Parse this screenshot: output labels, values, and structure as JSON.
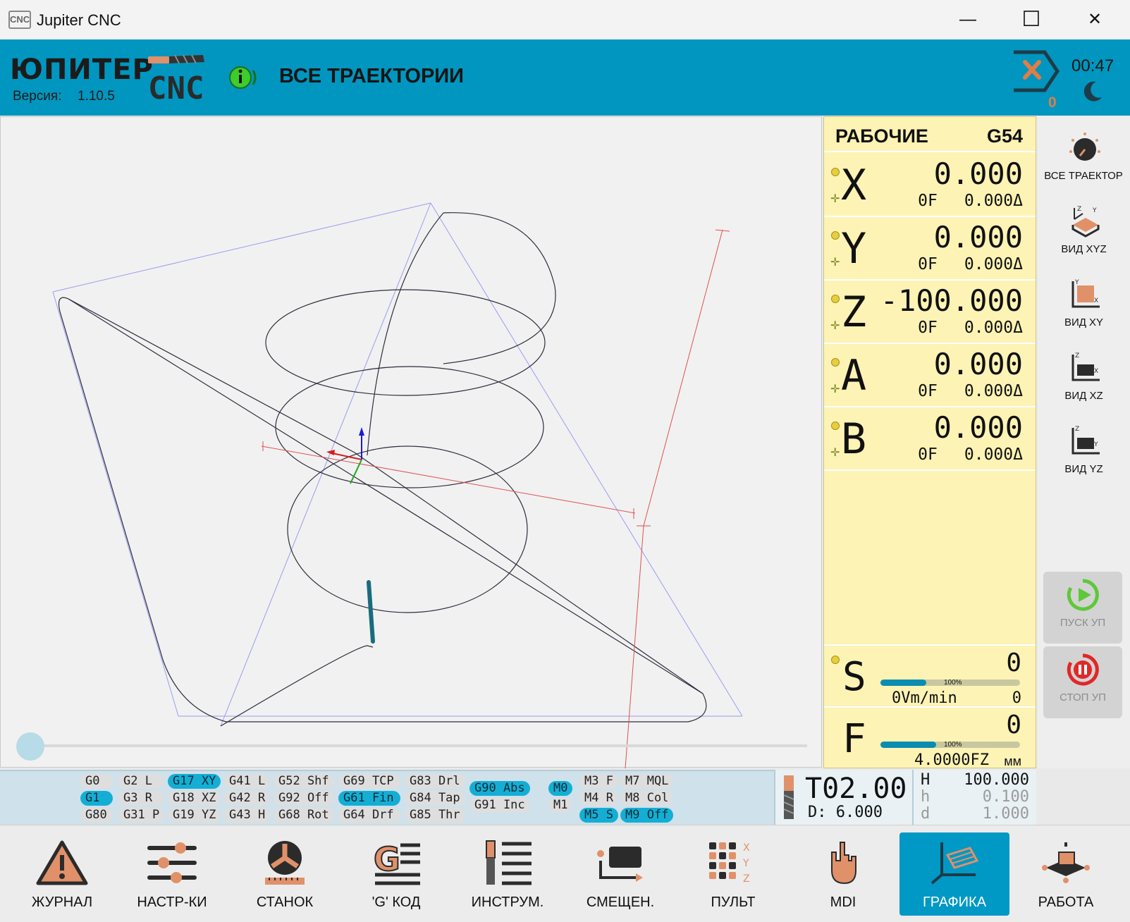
{
  "window": {
    "title": "Jupiter CNC",
    "app_icon_text": "CNC",
    "controls": {
      "minimize": "—",
      "maximize": "☐",
      "close": "✕"
    }
  },
  "header": {
    "brand": "ЮПИТЕР",
    "logo_text": "CNC",
    "version_label": "Версия:",
    "version": "1.10.5",
    "mode_title": "ВСЕ ТРАЕКТОРИИ",
    "estop_count": "0",
    "clock": "00:47",
    "accent_color": "#0096bf"
  },
  "dro": {
    "coordinate_system": "РАБОЧИЕ",
    "wcs": "G54",
    "axes": [
      {
        "letter": "X",
        "value": "0.000",
        "feed": "0",
        "feed_unit": "F",
        "delta": "0.000",
        "delta_unit": "Δ"
      },
      {
        "letter": "Y",
        "value": "0.000",
        "feed": "0",
        "feed_unit": "F",
        "delta": "0.000",
        "delta_unit": "Δ"
      },
      {
        "letter": "Z",
        "value": "-100.000",
        "feed": "0",
        "feed_unit": "F",
        "delta": "0.000",
        "delta_unit": "Δ"
      },
      {
        "letter": "A",
        "value": "0.000",
        "feed": "0",
        "feed_unit": "F",
        "delta": "0.000",
        "delta_unit": "Δ"
      },
      {
        "letter": "B",
        "value": "0.000",
        "feed": "0",
        "feed_unit": "F",
        "delta": "0.000",
        "delta_unit": "Δ"
      }
    ],
    "spindle": {
      "letter": "S",
      "value": "0",
      "override_pct": "100%",
      "override": 0.33,
      "sub_left": "0Vm/min",
      "sub_right": "0"
    },
    "feed": {
      "letter": "F",
      "value": "0",
      "override_pct": "100%",
      "override": 0.4,
      "sub_left": "4.0000FZ",
      "sub_unit": "мм"
    }
  },
  "views": [
    {
      "label": "ВСЕ ТРАЕКТОР",
      "icon": "dial-icon"
    },
    {
      "label": "ВИД XYZ",
      "icon": "view-xyz-icon"
    },
    {
      "label": "ВИД XY",
      "icon": "view-xy-icon"
    },
    {
      "label": "ВИД XZ",
      "icon": "view-xz-icon"
    },
    {
      "label": "ВИД YZ",
      "icon": "view-yz-icon"
    }
  ],
  "program_controls": {
    "start": "ПУСК УП",
    "stop": "СТОП УП"
  },
  "gcodes": [
    [
      "G0",
      "G1",
      "G80"
    ],
    [
      "G2 L",
      "G3 R",
      "G31 P"
    ],
    [
      "G17 XY",
      "G18 XZ",
      "G19 YZ"
    ],
    [
      "G41 L",
      "G42 R",
      "G43 H"
    ],
    [
      "G52 Shf",
      "G92 Off",
      "G68 Rot"
    ],
    [
      "G69 TCP",
      "G61 Fin",
      "G64 Drf"
    ],
    [
      "G83 Drl",
      "G84 Tap",
      "G85 Thr"
    ],
    [
      "G90 Abs",
      "G91 Inc"
    ],
    [
      "M0",
      "M1"
    ],
    [
      "M3 F",
      "M4 R",
      "M5 S"
    ],
    [
      "M7 MQL",
      "M8 Col",
      "M9 Off"
    ]
  ],
  "active_codes": [
    "G1",
    "G17 XY",
    "G61 Fin",
    "G90 Abs",
    "M0",
    "M5 S",
    "M9 Off"
  ],
  "tool": {
    "number": "T02.00",
    "diameter": "D: 6.000",
    "params": [
      {
        "key": "H",
        "value": "100.000"
      },
      {
        "key": "h",
        "value": "0.100"
      },
      {
        "key": "d",
        "value": "1.000"
      }
    ]
  },
  "nav": [
    {
      "label": "ЖУРНАЛ",
      "icon": "warning-icon"
    },
    {
      "label": "НАСТР-КИ",
      "icon": "sliders-icon"
    },
    {
      "label": "СТАНОК",
      "icon": "chuck-icon"
    },
    {
      "label": "'G' КОД",
      "icon": "gcode-icon"
    },
    {
      "label": "ИНСТРУМ.",
      "icon": "tool-list-icon"
    },
    {
      "label": "СМЕЩЕН.",
      "icon": "offset-icon"
    },
    {
      "label": "ПУЛЬТ",
      "icon": "keypad-icon"
    },
    {
      "label": "MDI",
      "icon": "hand-icon"
    },
    {
      "label": "ГРАФИКА",
      "icon": "graphics-icon",
      "active": true
    },
    {
      "label": "РАБОТА",
      "icon": "workpiece-icon"
    }
  ]
}
